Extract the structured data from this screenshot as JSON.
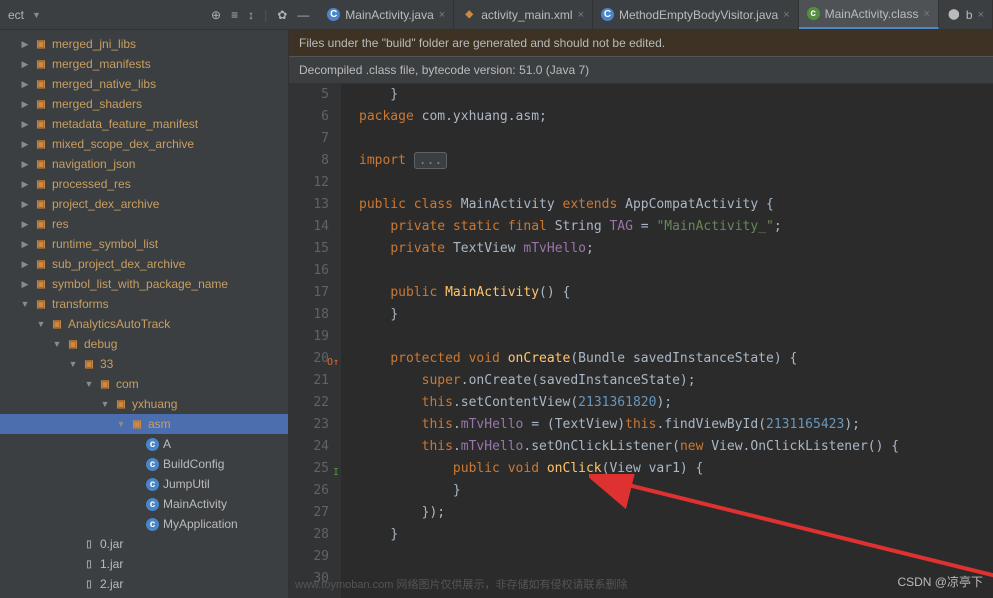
{
  "toolbar": {
    "project_label": "ect",
    "icons": [
      "target",
      "list",
      "expand",
      "divider",
      "settings",
      "minimize"
    ]
  },
  "tabs": [
    {
      "label": "MainActivity.java",
      "icon": "java",
      "active": false
    },
    {
      "label": "activity_main.xml",
      "icon": "xml",
      "active": false
    },
    {
      "label": "MethodEmptyBodyVisitor.java",
      "icon": "java",
      "active": false
    },
    {
      "label": "MainActivity.class",
      "icon": "class",
      "active": true
    },
    {
      "label": "b",
      "icon": "kotlin",
      "active": false
    }
  ],
  "banners": {
    "generated": "Files under the \"build\" folder are generated and should not be edited.",
    "decompiled": "Decompiled .class file, bytecode version: 51.0 (Java 7)"
  },
  "tree": [
    {
      "indent": 1,
      "chev": ">",
      "icon": "folder",
      "label": "merged_jni_libs"
    },
    {
      "indent": 1,
      "chev": ">",
      "icon": "folder",
      "label": "merged_manifests"
    },
    {
      "indent": 1,
      "chev": ">",
      "icon": "folder",
      "label": "merged_native_libs"
    },
    {
      "indent": 1,
      "chev": ">",
      "icon": "folder",
      "label": "merged_shaders"
    },
    {
      "indent": 1,
      "chev": ">",
      "icon": "folder",
      "label": "metadata_feature_manifest"
    },
    {
      "indent": 1,
      "chev": ">",
      "icon": "folder",
      "label": "mixed_scope_dex_archive"
    },
    {
      "indent": 1,
      "chev": ">",
      "icon": "folder",
      "label": "navigation_json"
    },
    {
      "indent": 1,
      "chev": ">",
      "icon": "folder",
      "label": "processed_res"
    },
    {
      "indent": 1,
      "chev": ">",
      "icon": "folder",
      "label": "project_dex_archive"
    },
    {
      "indent": 1,
      "chev": ">",
      "icon": "folder",
      "label": "res"
    },
    {
      "indent": 1,
      "chev": ">",
      "icon": "folder",
      "label": "runtime_symbol_list"
    },
    {
      "indent": 1,
      "chev": ">",
      "icon": "folder",
      "label": "sub_project_dex_archive"
    },
    {
      "indent": 1,
      "chev": ">",
      "icon": "folder",
      "label": "symbol_list_with_package_name"
    },
    {
      "indent": 1,
      "chev": "v",
      "icon": "folder",
      "label": "transforms"
    },
    {
      "indent": 2,
      "chev": "v",
      "icon": "folder",
      "label": "AnalyticsAutoTrack"
    },
    {
      "indent": 3,
      "chev": "v",
      "icon": "folder",
      "label": "debug"
    },
    {
      "indent": 4,
      "chev": "v",
      "icon": "folder",
      "label": "33"
    },
    {
      "indent": 5,
      "chev": "v",
      "icon": "folder",
      "label": "com"
    },
    {
      "indent": 6,
      "chev": "v",
      "icon": "folder",
      "label": "yxhuang"
    },
    {
      "indent": 7,
      "chev": "v",
      "icon": "folder",
      "label": "asm",
      "selected": true
    },
    {
      "indent": 8,
      "chev": "",
      "icon": "class",
      "label": "A"
    },
    {
      "indent": 8,
      "chev": "",
      "icon": "class",
      "label": "BuildConfig"
    },
    {
      "indent": 8,
      "chev": "",
      "icon": "class",
      "label": "JumpUtil"
    },
    {
      "indent": 8,
      "chev": "",
      "icon": "class",
      "label": "MainActivity"
    },
    {
      "indent": 8,
      "chev": "",
      "icon": "class",
      "label": "MyApplication"
    },
    {
      "indent": 4,
      "chev": "",
      "icon": "jar",
      "label": "0.jar"
    },
    {
      "indent": 4,
      "chev": "",
      "icon": "jar",
      "label": "1.jar"
    },
    {
      "indent": 4,
      "chev": "",
      "icon": "jar",
      "label": "2.jar"
    }
  ],
  "gutter_start": 5,
  "code": {
    "lines": [
      {
        "n": 5,
        "html": "<span class='plain'>    }</span>"
      },
      {
        "n": 6,
        "html": "<span class='kw'>package </span><span class='plain'>com.yxhuang.asm;</span>"
      },
      {
        "n": 7,
        "html": ""
      },
      {
        "n": 8,
        "html": "<span class='kw'>import </span><span class='fold'>...</span>"
      },
      {
        "n": 12,
        "html": ""
      },
      {
        "n": 13,
        "html": "<span class='kw'>public class </span><span class='plain'>MainActivity </span><span class='kw'>extends </span><span class='plain'>AppCompatActivity {</span>"
      },
      {
        "n": 14,
        "html": "    <span class='kw'>private static final </span><span class='plain'>String </span><span class='field'>TAG</span><span class='plain'> = </span><span class='str'>\"MainActivity_\"</span><span class='plain'>;</span>"
      },
      {
        "n": 15,
        "html": "    <span class='kw'>private </span><span class='plain'>TextView </span><span class='field'>mTvHello</span><span class='plain'>;</span>"
      },
      {
        "n": 16,
        "html": ""
      },
      {
        "n": 17,
        "html": "    <span class='kw'>public </span><span class='fn'>MainActivity</span><span class='plain'>() {</span>"
      },
      {
        "n": 18,
        "html": "    <span class='plain'>}</span>"
      },
      {
        "n": 19,
        "html": ""
      },
      {
        "n": 20,
        "html": "    <span class='kw'>protected void </span><span class='fn'>onCreate</span><span class='plain'>(Bundle savedInstanceState) {</span>"
      },
      {
        "n": 21,
        "html": "        <span class='kw'>super</span><span class='plain'>.onCreate(savedInstanceState);</span>"
      },
      {
        "n": 22,
        "html": "        <span class='kw'>this</span><span class='plain'>.setContentView(</span><span class='num'>2131361820</span><span class='plain'>);</span>"
      },
      {
        "n": 23,
        "html": "        <span class='kw'>this</span><span class='plain'>.</span><span class='field'>mTvHello</span><span class='plain'> = (TextView)</span><span class='kw'>this</span><span class='plain'>.findViewById(</span><span class='num'>2131165423</span><span class='plain'>);</span>"
      },
      {
        "n": 24,
        "html": "        <span class='kw'>this</span><span class='plain'>.</span><span class='field'>mTvHello</span><span class='plain'>.setOnClickListener(</span><span class='kw'>new </span><span class='plain'>View.OnClickListener() {</span>"
      },
      {
        "n": 25,
        "html": "            <span class='kw'>public void </span><span class='fn'>onClick</span><span class='plain'>(View var1) {</span>"
      },
      {
        "n": 26,
        "html": "            <span class='plain'>}</span>"
      },
      {
        "n": 27,
        "html": "        <span class='plain'>});</span>"
      },
      {
        "n": 28,
        "html": "    <span class='plain'>}</span>"
      },
      {
        "n": 29,
        "html": ""
      },
      {
        "n": 30,
        "html": ""
      }
    ]
  },
  "watermark": "www.toymoban.com  网络图片仅供展示，非存储如有侵权请联系删除",
  "csdn": "CSDN @凉亭下"
}
